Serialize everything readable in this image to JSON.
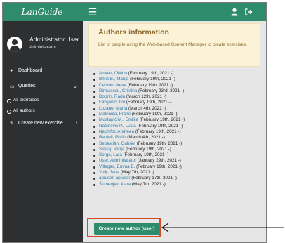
{
  "app": {
    "brand": "LanGuide"
  },
  "topbar": {
    "menu_icon": "hamburger-icon",
    "user_icon": "user-icon",
    "logout_icon": "logout-icon"
  },
  "sidebar": {
    "user_name": "Administrator User",
    "user_role": "Administrator",
    "items": [
      {
        "label": "Dashboard",
        "icon": "dashboard-icon"
      },
      {
        "label": "Queries",
        "icon": "monitor-icon",
        "expanded": true
      },
      {
        "label": "All exercises",
        "icon": "circle-icon"
      },
      {
        "label": "All authors",
        "icon": "circle-icon",
        "active": true
      },
      {
        "label": "Create new exercise",
        "icon": "edit-icon"
      }
    ]
  },
  "info": {
    "title": "Authors information",
    "description": "List of people using the Web-based Content Manager to create exercises."
  },
  "authors": [
    {
      "name": "Arraez, Olvido",
      "date": "(February 19th, 2021 -)"
    },
    {
      "name": "Brkić B., Marija",
      "date": "(February 19th, 2021 -)"
    },
    {
      "name": "Cebron, Neva",
      "date": "(February 19th, 2021 -)"
    },
    {
      "name": "Dimulescu, Cristina",
      "date": "(February 23rd, 2021 -)"
    },
    {
      "name": "Dobrin, Radu",
      "date": "(March 12th, 2021 -)"
    },
    {
      "name": "Fabijanić, Ivo",
      "date": "(February 19th, 2021 -)"
    },
    {
      "name": "Lozano, María",
      "date": "(March 4th, 2021 -)"
    },
    {
      "name": "Malenica, Frane",
      "date": "(February 19th, 2021 -)"
    },
    {
      "name": "Mustapić M., Emilija",
      "date": "(February 19th, 2021 -)"
    },
    {
      "name": "Načinović P., Lucia",
      "date": "(February 19th, 2021 -)"
    },
    {
      "name": "Nechifor, Andreea",
      "date": "(February 19th, 2021 -)"
    },
    {
      "name": "Rautell, Philip",
      "date": "(March 4th, 2021 -)"
    },
    {
      "name": "Sebastián, Gabriel",
      "date": "(February 19th, 2021 -)"
    },
    {
      "name": "Slavuj, Vanja",
      "date": "(February 19th, 2021 -)"
    },
    {
      "name": "Sorgo, Lara",
      "date": "(February 19th, 2021 -)"
    },
    {
      "name": "User, Administrator",
      "date": "(January 29th, 2021 -)"
    },
    {
      "name": "Villegas, Emma B.",
      "date": "(February 19th, 2021 -)"
    },
    {
      "name": "Volk, Jana",
      "date": "(May 7th, 2021 -)"
    },
    {
      "name": "apiuser, apiuser",
      "date": "(February 17th, 2021 -)"
    },
    {
      "name": "Šumenjak, klara",
      "date": "(May 7th, 2021 -)"
    }
  ],
  "create_button": {
    "label": "Create new author (user)"
  },
  "colors": {
    "primary": "#2e8b6c",
    "sidebar": "#2d2f31",
    "highlight": "#d64a28",
    "info_bg": "#fbf2d8",
    "info_text": "#8d6d2f",
    "link": "#2f7ea7"
  }
}
